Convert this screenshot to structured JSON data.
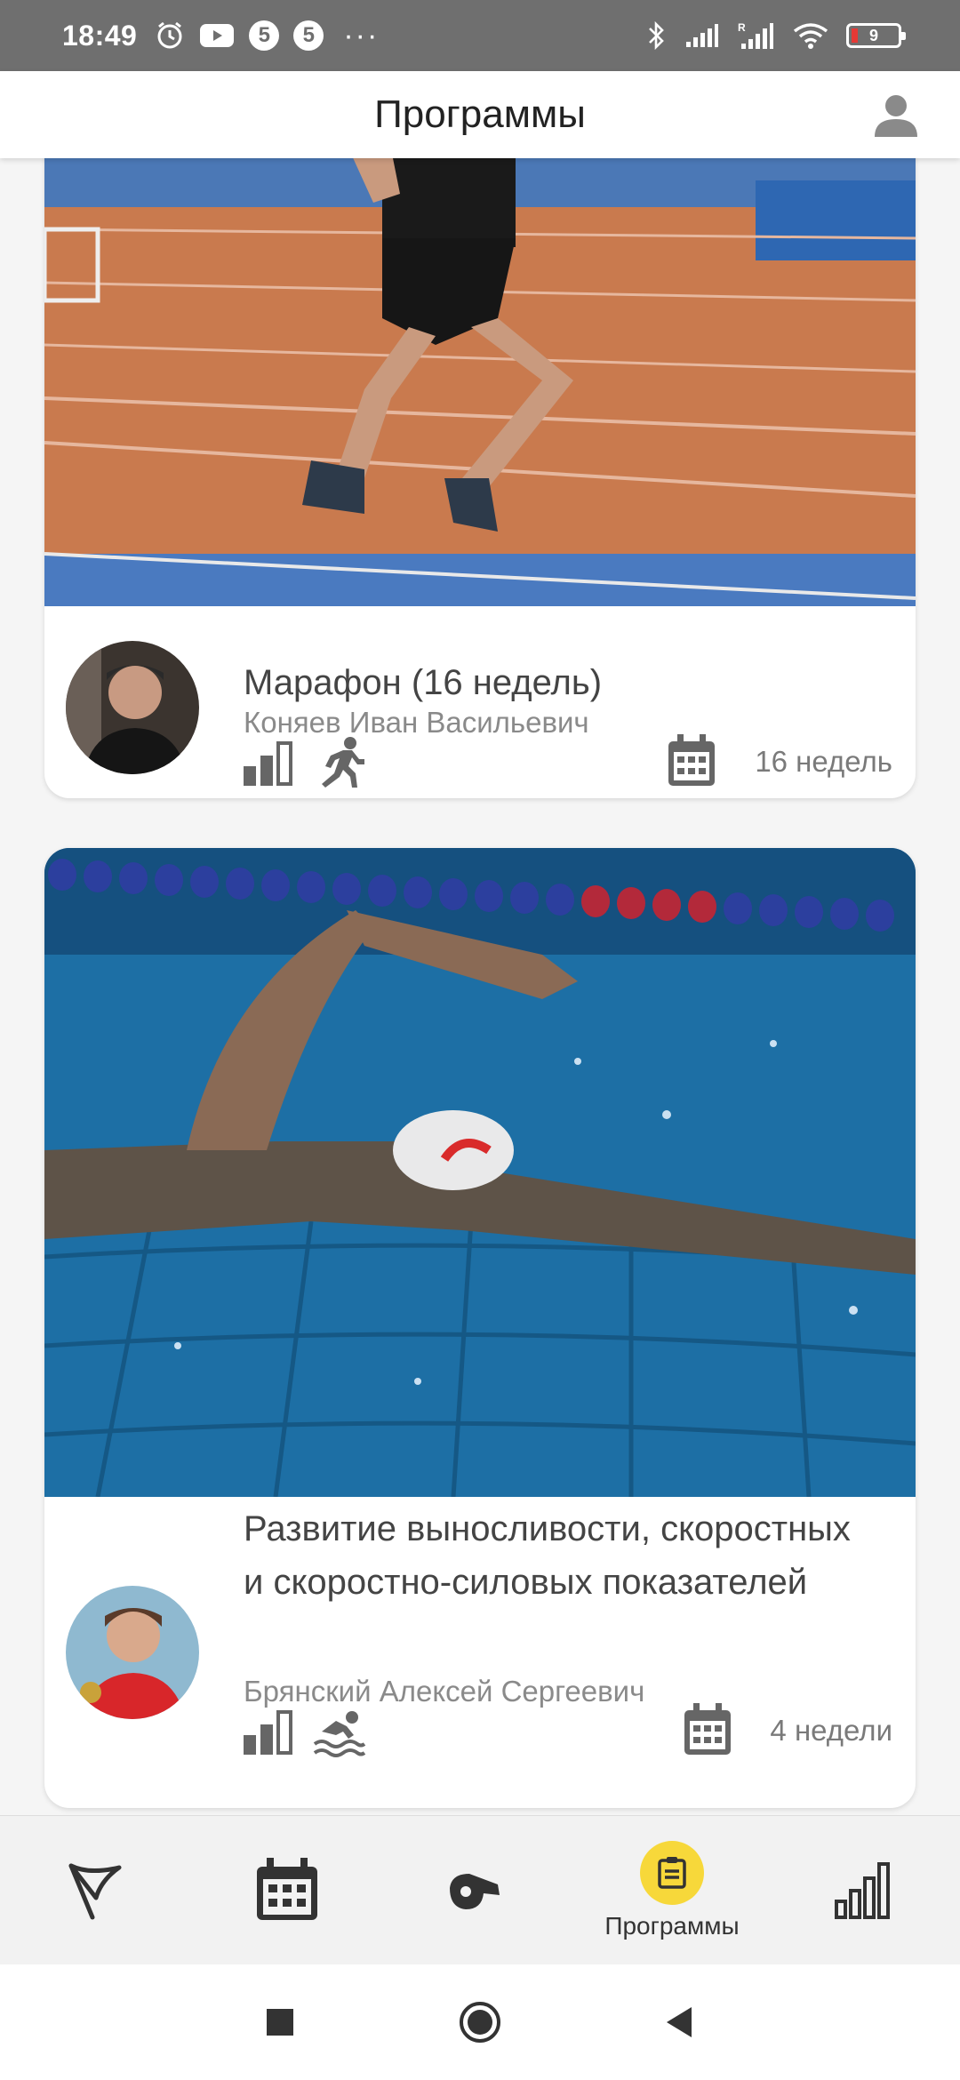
{
  "status_bar": {
    "time": "18:49",
    "notification_badges": [
      "5",
      "5"
    ],
    "more_indicator": "···",
    "battery_level": "9"
  },
  "app_bar": {
    "title": "Программы",
    "profile_icon": "account-icon"
  },
  "programs": [
    {
      "title": "Марафон (16 недель)",
      "author": "Коняев Иван Васильевич",
      "duration": "16 недель",
      "sport_icon": "running-icon",
      "level_icon": "level-icon",
      "image": "runner-track-photo"
    },
    {
      "title": "Развитие выносливости, скоростных и скоростно-силовых показателей",
      "author": "Брянский Алексей Сергеевич",
      "duration": "4 недели",
      "sport_icon": "swimming-icon",
      "level_icon": "level-icon",
      "image": "swimmer-pool-photo"
    }
  ],
  "bottom_nav": {
    "items": [
      {
        "icon": "flag-icon",
        "label": ""
      },
      {
        "icon": "calendar-icon",
        "label": ""
      },
      {
        "icon": "whistle-icon",
        "label": ""
      },
      {
        "icon": "program-icon",
        "label": "Программы",
        "active": true
      },
      {
        "icon": "stats-icon",
        "label": ""
      }
    ],
    "active_color": "#f7d83a"
  },
  "colors": {
    "status_bar": "#6f6f6f",
    "accent": "#f7d83a",
    "track": "#c97a4e",
    "pool": "#1d6fa5"
  }
}
